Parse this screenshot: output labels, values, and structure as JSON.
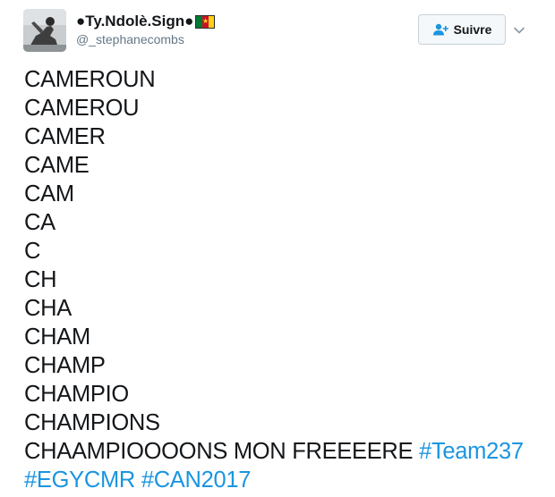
{
  "user": {
    "display_name": "●Ty.Ndolè.Sign●",
    "handle": "@_stephanecombs",
    "flag": "cameroon-flag"
  },
  "actions": {
    "follow_label": "Suivre",
    "follow_icon": "person-add-icon",
    "more_icon": "chevron-down-icon"
  },
  "tweet": {
    "lines": [
      "CAMEROUN",
      "CAMEROU",
      "CAMER",
      "CAME",
      "CAM",
      "CA",
      "C",
      "CH",
      "CHA",
      "CHAM",
      "CHAMP",
      "CHAMPIO",
      "CHAMPIONS"
    ],
    "last_line_text": "CHAAMPIOOOONS MON FREEEERE",
    "hashtags": [
      "#Team237",
      "#EGYCMR",
      "#CAN2017"
    ]
  },
  "colors": {
    "text": "#14171a",
    "secondary": "#657786",
    "link": "#1b95e0",
    "button_bg": "#f5f8fa",
    "button_border": "#c8d2d9"
  }
}
